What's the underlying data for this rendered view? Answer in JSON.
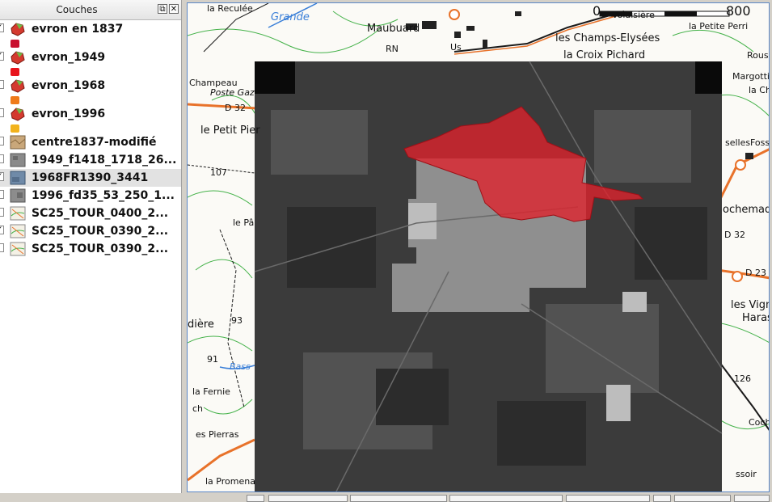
{
  "panel": {
    "title": "Couches",
    "float_glyph": "⧉",
    "close_glyph": "✕"
  },
  "layers": [
    {
      "name": "evron en 1837",
      "checked": true,
      "icon": "polygon-layer-icon",
      "swatch": "#c8102e"
    },
    {
      "name": "evron_1949",
      "checked": true,
      "icon": "polygon-layer-icon",
      "swatch": "#e8141c"
    },
    {
      "name": "evron_1968",
      "checked": false,
      "icon": "polygon-layer-icon",
      "swatch": "#ef7a1a"
    },
    {
      "name": "evron_1996",
      "checked": false,
      "icon": "polygon-layer-icon",
      "swatch": "#f2b21c"
    },
    {
      "name": "centre1837-modifié",
      "checked": false,
      "icon": "raster-layer-icon"
    },
    {
      "name": "1949_f1418_1718_26...",
      "checked": false,
      "icon": "raster-layer-icon"
    },
    {
      "name": "1968FR1390_3441",
      "checked": true,
      "icon": "raster-layer-icon",
      "selected": true
    },
    {
      "name": "1996_fd35_53_250_1...",
      "checked": false,
      "icon": "raster-layer-icon"
    },
    {
      "name": "SC25_TOUR_0400_2...",
      "checked": false,
      "icon": "map-raster-icon"
    },
    {
      "name": "SC25_TOUR_0390_2...",
      "checked": true,
      "icon": "map-raster-icon"
    },
    {
      "name": "SC25_TOUR_0390_2...",
      "checked": false,
      "icon": "map-raster-icon"
    }
  ],
  "map": {
    "scale_start": "0",
    "scale_end": "800",
    "labels": {
      "la_reculee": "la Reculée",
      "grande": "Grande",
      "maubuard": "Maubuard",
      "volaisiere": "Volaisière",
      "la_petite_perrine": "la Petite Perri",
      "les_champs_elysees": "les Champs-Elysées",
      "la_croix_pichard": "la Croix Pichard",
      "rousse": "Rous",
      "rn": "RN",
      "les_us": "Us",
      "champeau": "Champeau",
      "poste_gaz": "Poste Gaz",
      "d32": "D 32",
      "le_petit_pierre": "le Petit Pier",
      "margottiere": "Margottie",
      "la_ch": "la Ch",
      "fosses": "Foss",
      "selles": "selles",
      "lochemad": "ochemad",
      "d32b": "D 32",
      "n107": "107",
      "le_pa": "le Pâ",
      "d23": "D 23",
      "les_vignes": "les Vign",
      "haras": "Haras",
      "diere": "dière",
      "n93": "93",
      "n91": "91",
      "bass": "Bass",
      "la_fernie": "la Fernie",
      "ch": "ch",
      "les_pierras": "es Pierras",
      "la_promena": "la Promena",
      "n126": "126",
      "cochin": "Cochin",
      "essoir": "ssoir"
    }
  },
  "colors": {
    "selection_red": "#e0212c",
    "map_border": "#5b87c7",
    "road_orange": "#e8722a",
    "road_black": "#1a1a1a",
    "contour_green": "#45b24a",
    "water_blue": "#3a7fd8"
  }
}
